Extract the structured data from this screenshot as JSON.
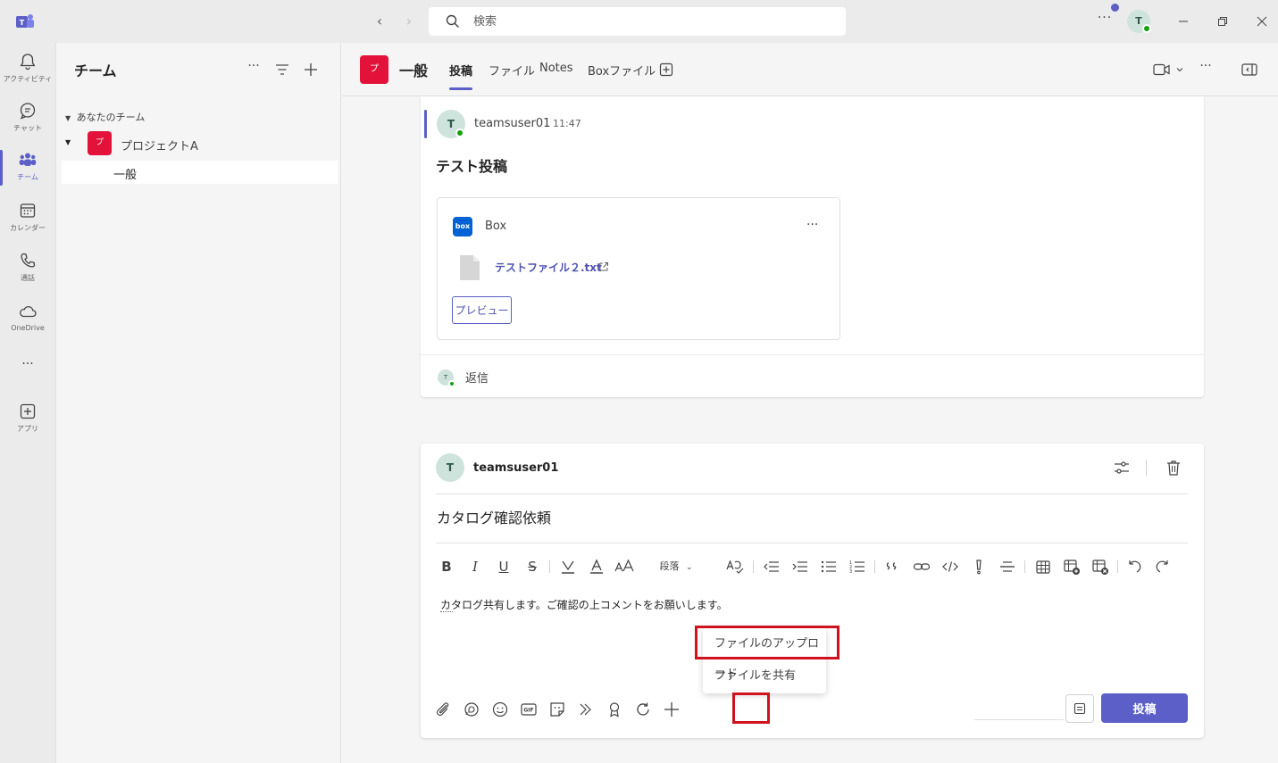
{
  "titlebar": {
    "search_placeholder": "検索",
    "avatar_initial": "T",
    "more": "···"
  },
  "rail": {
    "items": [
      {
        "label": "アクティビティ",
        "icon": "bell-icon"
      },
      {
        "label": "チャット",
        "icon": "chat-icon"
      },
      {
        "label": "チーム",
        "icon": "teams-icon"
      },
      {
        "label": "カレンダー",
        "icon": "calendar-icon"
      },
      {
        "label": "通話",
        "icon": "phone-icon"
      },
      {
        "label": "OneDrive",
        "icon": "cloud-icon"
      },
      {
        "label": "アプリ",
        "icon": "apps-icon"
      }
    ],
    "more": "···"
  },
  "teams_panel": {
    "title": "チーム",
    "more": "···",
    "section": "あなたのチーム",
    "team": {
      "name": "プロジェクトA",
      "avatar": "プ"
    },
    "channel": "一般"
  },
  "header": {
    "avatar": "プ",
    "title": "一般",
    "tabs": [
      "投稿",
      "ファイル",
      "Notes",
      "Boxファイル"
    ],
    "more": "···"
  },
  "message": {
    "avatar": "T",
    "author": "teamsuser01",
    "time": "11:47",
    "subject": "テスト投稿",
    "box": {
      "logo": "box",
      "name": "Box",
      "more": "···",
      "file": "テストファイル２.txt",
      "preview": "プレビュー"
    },
    "reply_avatar": "T",
    "reply": "返信"
  },
  "composer": {
    "avatar": "T",
    "author": "teamsuser01",
    "subject": "カタログ確認依頼",
    "paragraph_style": "段落",
    "body": "カタログ共有します。ご確認の上コメントをお願いします。",
    "menu": [
      "ファイルのアップロード",
      "ファイルを共有"
    ],
    "post_label": "投稿",
    "fmt": {
      "bold": "B",
      "italic": "I",
      "underline": "U",
      "strike": "S"
    }
  },
  "colors": {
    "accent": "#5b5fc7",
    "team_red": "#e3123a",
    "highlight_red": "#d0121e",
    "box_blue": "#0061d5",
    "presence_green": "#13a10e"
  }
}
